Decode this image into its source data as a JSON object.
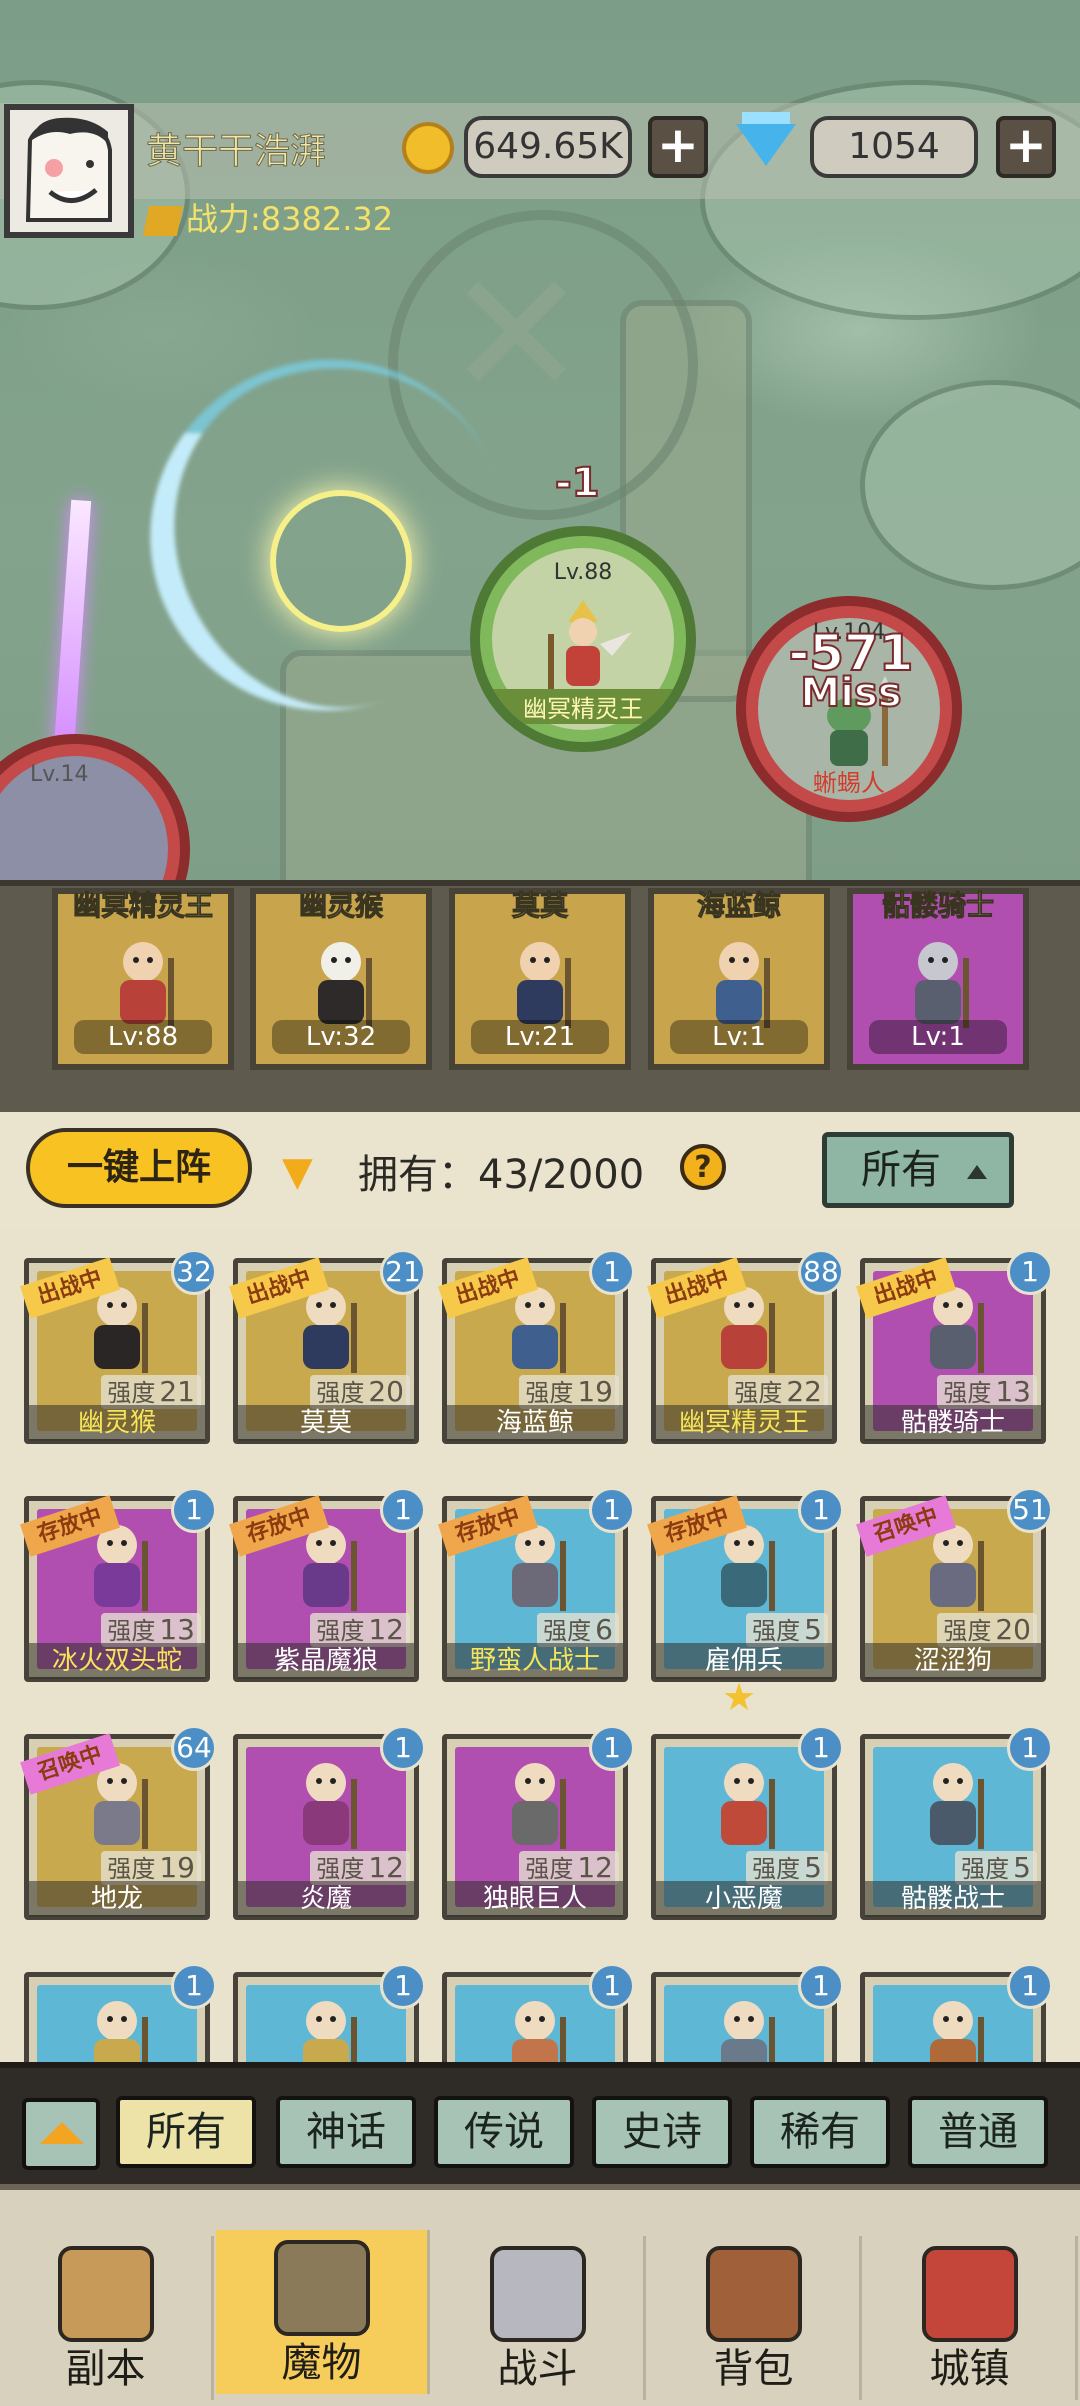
{
  "player": {
    "name": "黄干干浩湃",
    "gold": "649.65K",
    "gems": "1054",
    "power": "战力:8382.32"
  },
  "battle": {
    "hit_minus": "-1",
    "center_unit": {
      "level": "Lv.88",
      "name": "幽冥精灵王"
    },
    "right_unit": {
      "level": "Lv.104",
      "name": "蜥蜴人",
      "damage": "-571",
      "status": "Miss"
    },
    "left_unit": {
      "level": "Lv.14"
    }
  },
  "lineup": [
    {
      "title": "幽冥精灵王",
      "level": "Lv:88",
      "rarity_color": "#c8a54c"
    },
    {
      "title": "幽灵猴",
      "level": "Lv:32",
      "rarity_color": "#c8a54c"
    },
    {
      "title": "莫莫",
      "level": "Lv:21",
      "rarity_color": "#c8a54c"
    },
    {
      "title": "海蓝鲸",
      "level": "Lv:1",
      "rarity_color": "#c8a54c"
    },
    {
      "title": "骷髅骑士",
      "level": "Lv:1",
      "rarity_color": "#b04fb0"
    }
  ],
  "controls": {
    "deploy_label": "一键上阵",
    "owned_label": "拥有：43/2000",
    "help": "?",
    "filter_selected": "所有"
  },
  "monsters": [
    {
      "name": "幽灵猴",
      "strength": "21",
      "badge": "32",
      "tag": "出战中",
      "bg": "#c9a94d",
      "name_color": "#f6e45a"
    },
    {
      "name": "莫莫",
      "strength": "20",
      "badge": "21",
      "tag": "出战中",
      "bg": "#c9a94d",
      "name_color": "#ffffff"
    },
    {
      "name": "海蓝鲸",
      "strength": "19",
      "badge": "1",
      "tag": "出战中",
      "bg": "#c9a94d",
      "name_color": "#ffffff"
    },
    {
      "name": "幽冥精灵王",
      "strength": "22",
      "badge": "88",
      "tag": "出战中",
      "bg": "#c9a94d",
      "name_color": "#f6e45a"
    },
    {
      "name": "骷髅骑士",
      "strength": "13",
      "badge": "1",
      "tag": "出战中",
      "bg": "#b04fb0",
      "name_color": "#ffffff"
    },
    {
      "name": "冰火双头蛇",
      "strength": "13",
      "badge": "1",
      "tag": "存放中",
      "bg": "#b04fb0",
      "name_color": "#f6e45a"
    },
    {
      "name": "紫晶魔狼",
      "strength": "12",
      "badge": "1",
      "tag": "存放中",
      "bg": "#b04fb0",
      "name_color": "#ffffff"
    },
    {
      "name": "野蛮人战士",
      "strength": "6",
      "badge": "1",
      "tag": "存放中",
      "bg": "#5fb7d6",
      "name_color": "#f6e45a"
    },
    {
      "name": "雇佣兵",
      "strength": "5",
      "badge": "1",
      "tag": "存放中",
      "bg": "#5fb7d6",
      "name_color": "#ffffff"
    },
    {
      "name": "涩涩狗",
      "strength": "20",
      "badge": "51",
      "tag": "召唤中",
      "bg": "#c9a94d",
      "name_color": "#ffffff"
    },
    {
      "name": "地龙",
      "strength": "19",
      "badge": "64",
      "tag": "召唤中",
      "bg": "#c9a94d",
      "name_color": "#ffffff"
    },
    {
      "name": "炎魔",
      "strength": "12",
      "badge": "1",
      "tag": "",
      "bg": "#b04fb0",
      "name_color": "#ffffff"
    },
    {
      "name": "独眼巨人",
      "strength": "12",
      "badge": "1",
      "tag": "",
      "bg": "#b04fb0",
      "name_color": "#ffffff"
    },
    {
      "name": "小恶魔",
      "strength": "5",
      "badge": "1",
      "tag": "",
      "bg": "#5fb7d6",
      "name_color": "#ffffff"
    },
    {
      "name": "骷髅战士",
      "strength": "5",
      "badge": "1",
      "tag": "",
      "bg": "#5fb7d6",
      "name_color": "#ffffff"
    },
    {
      "name": "",
      "strength": "",
      "badge": "1",
      "tag": "",
      "bg": "#5fb7d6",
      "name_color": "#ffffff"
    },
    {
      "name": "",
      "strength": "",
      "badge": "1",
      "tag": "",
      "bg": "#5fb7d6",
      "name_color": "#ffffff"
    },
    {
      "name": "",
      "strength": "",
      "badge": "1",
      "tag": "",
      "bg": "#5fb7d6",
      "name_color": "#ffffff"
    },
    {
      "name": "",
      "strength": "",
      "badge": "1",
      "tag": "",
      "bg": "#5fb7d6",
      "name_color": "#ffffff"
    },
    {
      "name": "",
      "strength": "",
      "badge": "1",
      "tag": "",
      "bg": "#5fb7d6",
      "name_color": "#ffffff"
    }
  ],
  "strength_label": "强度",
  "rarity_filters": [
    "所有",
    "神话",
    "传说",
    "史诗",
    "稀有",
    "普通"
  ],
  "nav": [
    {
      "label": "副本",
      "icon": "map-scroll-icon"
    },
    {
      "label": "魔物",
      "icon": "monster-helmet-icon",
      "active": true
    },
    {
      "label": "战斗",
      "icon": "crossed-swords-icon"
    },
    {
      "label": "背包",
      "icon": "backpack-icon"
    },
    {
      "label": "城镇",
      "icon": "shop-building-icon"
    }
  ],
  "colors": {
    "gold": "#f8c322",
    "tag_active": "#f6c94a",
    "tag_store": "#f0a64a",
    "tag_summon": "#e77ad6",
    "badge": "#4c8fc6"
  }
}
